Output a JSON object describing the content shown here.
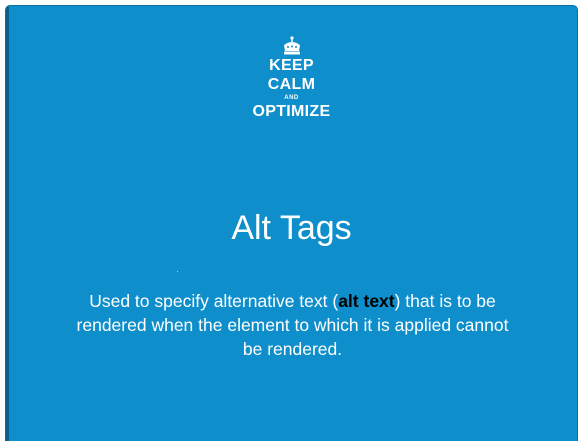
{
  "logo": {
    "icon": "crown-icon",
    "line1": "KEEP",
    "line2": "CALM",
    "line3": "AND",
    "line4": "OPTIMIZE"
  },
  "slide": {
    "title": "Alt Tags",
    "body_part1": "Used to specify alternative text (",
    "body_highlight": "alt text",
    "body_part2": ") that is to be rendered when the element to which it is applied cannot be rendered."
  },
  "colors": {
    "background": "#0e8ecb",
    "text": "#ffffff",
    "highlight": "#000000"
  }
}
